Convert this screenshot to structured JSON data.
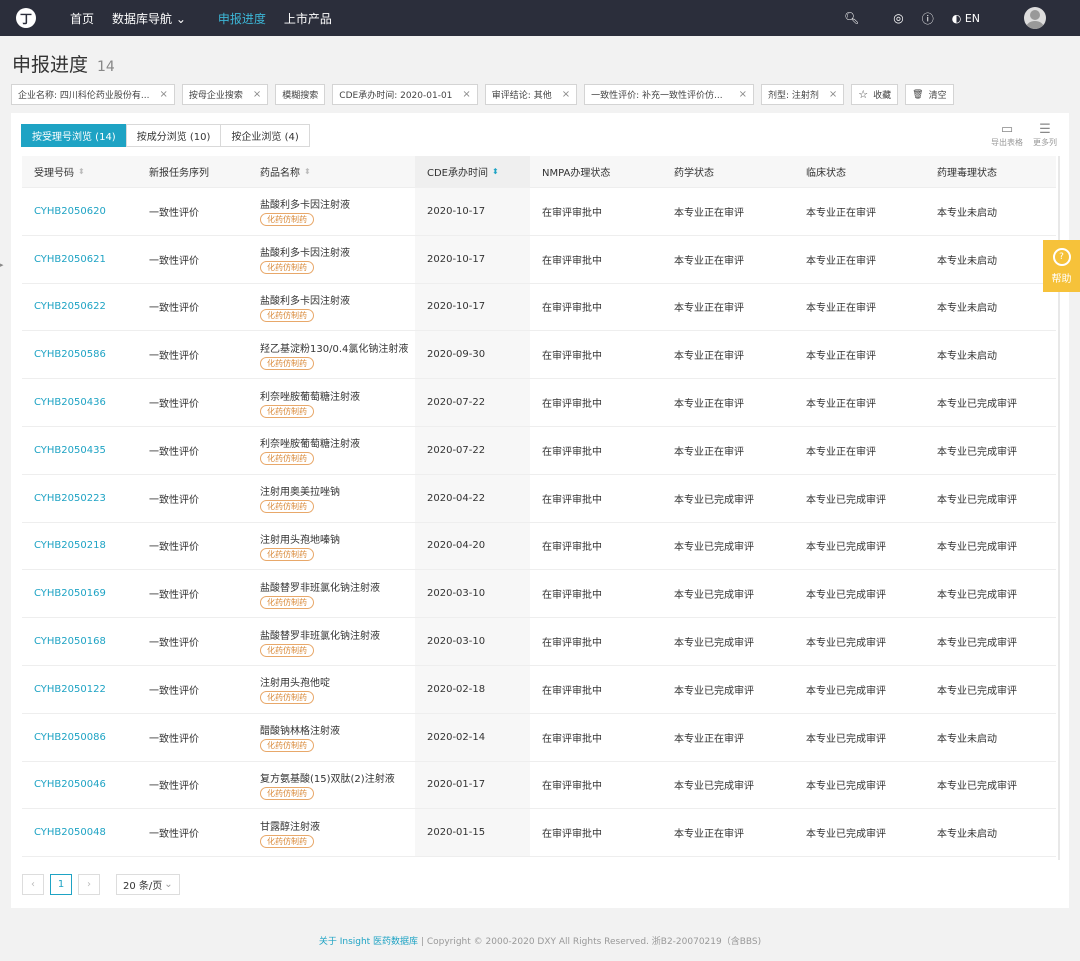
{
  "nav": {
    "logo": "丁",
    "items": [
      "首页",
      "数据库导航 ⌄",
      "申报进度",
      "上市产品"
    ],
    "lang": "EN"
  },
  "page": {
    "title": "申报进度",
    "count": "14"
  },
  "filters": [
    "企业名称: 四川科伦药业股份有...",
    "按母企业搜索",
    "模糊搜索",
    "CDE承办时间: 2020-01-01",
    "审评结论: 其他",
    "一致性评价: 补充一致性评价仿...",
    "剂型: 注射剂",
    "收藏",
    "清空"
  ],
  "tabs": [
    "按受理号浏览 (14)",
    "按成分浏览 (10)",
    "按企业浏览 (4)"
  ],
  "tools": {
    "export": "导出表格",
    "more": "更多列"
  },
  "columns": [
    "受理号码",
    "新报任务序列",
    "药品名称",
    "CDE承办时间",
    "NMPA办理状态",
    "药学状态",
    "临床状态",
    "药理毒理状态"
  ],
  "tag": "化药仿制药",
  "rows": [
    [
      "CYHB2050620",
      "一致性评价",
      "盐酸利多卡因注射液",
      "2020-10-17",
      "在审评审批中",
      "本专业正在审评",
      "本专业正在审评",
      "本专业未启动"
    ],
    [
      "CYHB2050621",
      "一致性评价",
      "盐酸利多卡因注射液",
      "2020-10-17",
      "在审评审批中",
      "本专业正在审评",
      "本专业正在审评",
      "本专业未启动"
    ],
    [
      "CYHB2050622",
      "一致性评价",
      "盐酸利多卡因注射液",
      "2020-10-17",
      "在审评审批中",
      "本专业正在审评",
      "本专业正在审评",
      "本专业未启动"
    ],
    [
      "CYHB2050586",
      "一致性评价",
      "羟乙基淀粉130/0.4氯化钠注射液",
      "2020-09-30",
      "在审评审批中",
      "本专业正在审评",
      "本专业正在审评",
      "本专业未启动"
    ],
    [
      "CYHB2050436",
      "一致性评价",
      "利奈唑胺葡萄糖注射液",
      "2020-07-22",
      "在审评审批中",
      "本专业正在审评",
      "本专业正在审评",
      "本专业已完成审评"
    ],
    [
      "CYHB2050435",
      "一致性评价",
      "利奈唑胺葡萄糖注射液",
      "2020-07-22",
      "在审评审批中",
      "本专业正在审评",
      "本专业正在审评",
      "本专业已完成审评"
    ],
    [
      "CYHB2050223",
      "一致性评价",
      "注射用奥美拉唑钠",
      "2020-04-22",
      "在审评审批中",
      "本专业已完成审评",
      "本专业已完成审评",
      "本专业已完成审评"
    ],
    [
      "CYHB2050218",
      "一致性评价",
      "注射用头孢地嗪钠",
      "2020-04-20",
      "在审评审批中",
      "本专业已完成审评",
      "本专业已完成审评",
      "本专业已完成审评"
    ],
    [
      "CYHB2050169",
      "一致性评价",
      "盐酸替罗非班氯化钠注射液",
      "2020-03-10",
      "在审评审批中",
      "本专业已完成审评",
      "本专业已完成审评",
      "本专业已完成审评"
    ],
    [
      "CYHB2050168",
      "一致性评价",
      "盐酸替罗非班氯化钠注射液",
      "2020-03-10",
      "在审评审批中",
      "本专业已完成审评",
      "本专业已完成审评",
      "本专业已完成审评"
    ],
    [
      "CYHB2050122",
      "一致性评价",
      "注射用头孢他啶",
      "2020-02-18",
      "在审评审批中",
      "本专业已完成审评",
      "本专业已完成审评",
      "本专业已完成审评"
    ],
    [
      "CYHB2050086",
      "一致性评价",
      "醋酸钠林格注射液",
      "2020-02-14",
      "在审评审批中",
      "本专业正在审评",
      "本专业已完成审评",
      "本专业未启动"
    ],
    [
      "CYHB2050046",
      "一致性评价",
      "复方氨基酸(15)双肽(2)注射液",
      "2020-01-17",
      "在审评审批中",
      "本专业已完成审评",
      "本专业已完成审评",
      "本专业已完成审评"
    ],
    [
      "CYHB2050048",
      "一致性评价",
      "甘露醇注射液",
      "2020-01-15",
      "在审评审批中",
      "本专业正在审评",
      "本专业已完成审评",
      "本专业未启动"
    ]
  ],
  "pager": {
    "current": "1",
    "size": "20 条/页"
  },
  "help": "帮助",
  "footer": {
    "link": "关于 Insight 医药数据库",
    "text": " | Copyright © 2000-2020 DXY All Rights Reserved. 浙B2-20070219（含BBS)"
  }
}
